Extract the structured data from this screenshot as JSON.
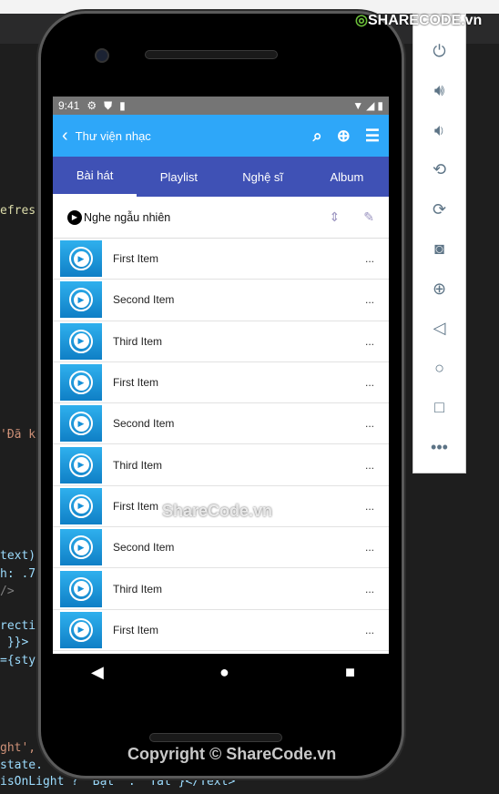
{
  "watermark": {
    "logo": "SHARECODE.vn",
    "center": "ShareCode.vn",
    "copyright": "Copyright © ShareCode.vn"
  },
  "code_fragments": [
    "efres",
    "'Đã k",
    "text)",
    "h: .7",
    "/>",
    "recti",
    " }}>",
    "={sty",
    "ght',",
    "state.",
    "isOnLight ? 'Bật' : 'Tắt'}</Text>"
  ],
  "status": {
    "time": "9:41"
  },
  "appbar": {
    "title": "Thư viện nhạc"
  },
  "tabs": [
    {
      "label": "Bài hát",
      "active": true
    },
    {
      "label": "Playlist"
    },
    {
      "label": "Nghệ sĩ"
    },
    {
      "label": "Album"
    }
  ],
  "shuffle": {
    "label": "Nghe ngẫu nhiên"
  },
  "items": [
    {
      "name": "First Item",
      "more": "..."
    },
    {
      "name": "Second Item",
      "more": "..."
    },
    {
      "name": "Third Item",
      "more": "..."
    },
    {
      "name": "First Item",
      "more": "..."
    },
    {
      "name": "Second Item",
      "more": "..."
    },
    {
      "name": "Third Item",
      "more": "..."
    },
    {
      "name": "First Item",
      "more": "..."
    },
    {
      "name": "Second Item",
      "more": "..."
    },
    {
      "name": "Third Item",
      "more": "..."
    },
    {
      "name": "First Item",
      "more": "..."
    }
  ],
  "colors": {
    "appbar": "#2ea7f9",
    "tabs": "#3f51b5",
    "statusbar": "#757575"
  }
}
